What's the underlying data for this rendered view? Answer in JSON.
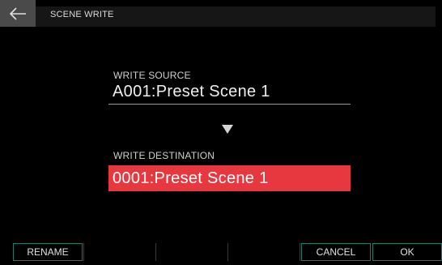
{
  "header": {
    "back_icon": "arrow-left-icon",
    "title": "SCENE WRITE"
  },
  "source": {
    "label": "WRITE SOURCE",
    "value": "A001:Preset Scene 1"
  },
  "direction_icon": "triangle-down-icon",
  "destination": {
    "label": "WRITE DESTINATION",
    "value": "0001:Preset Scene 1",
    "highlight_color": "#e8383f"
  },
  "function_buttons": {
    "rename": "RENAME",
    "cancel": "CANCEL",
    "ok": "OK",
    "border_color": "#1f7a6e"
  }
}
